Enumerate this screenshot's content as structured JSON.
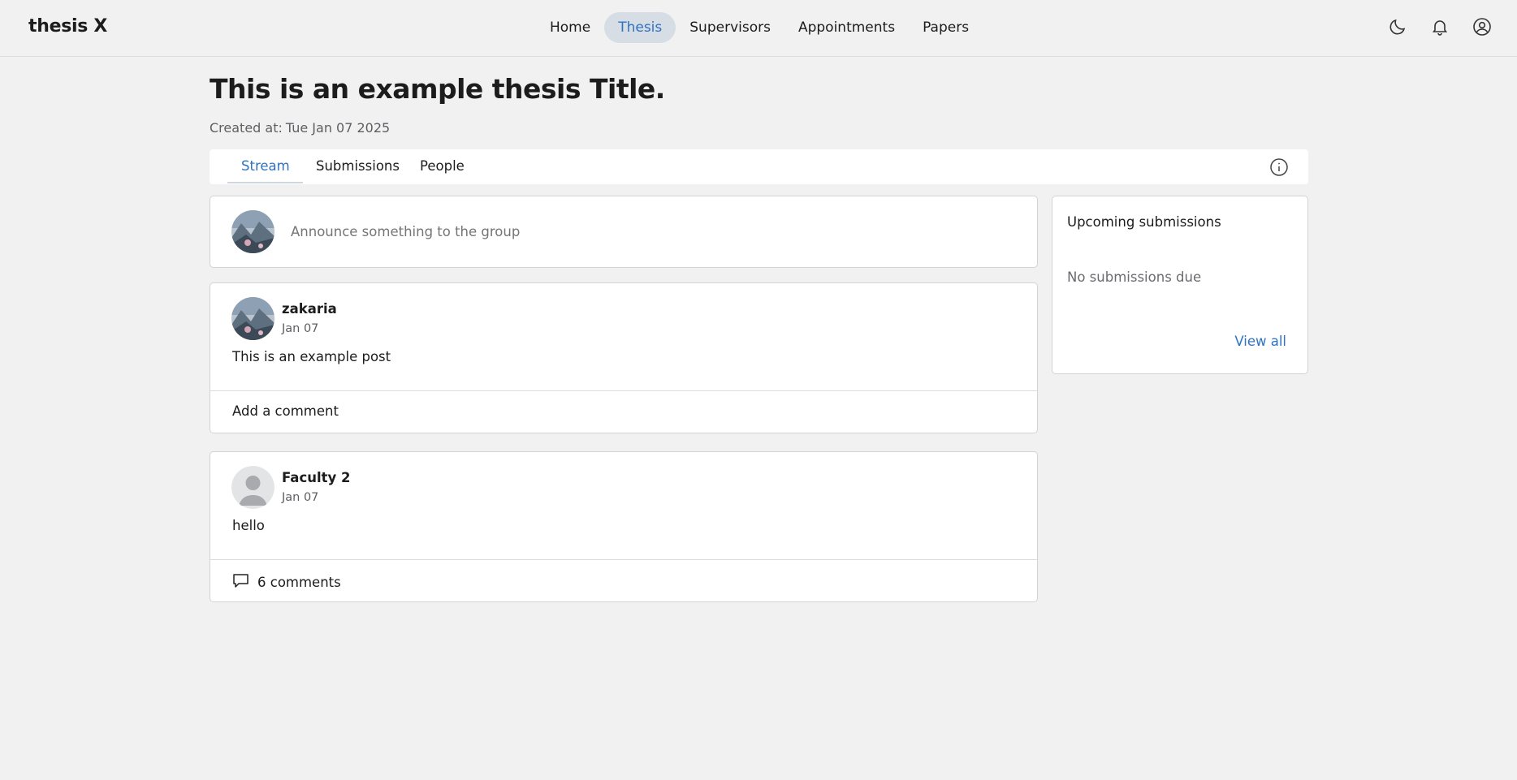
{
  "app": {
    "brand": "thesis X"
  },
  "nav": {
    "items": [
      {
        "label": "Home",
        "active": false
      },
      {
        "label": "Thesis",
        "active": true
      },
      {
        "label": "Supervisors",
        "active": false
      },
      {
        "label": "Appointments",
        "active": false
      },
      {
        "label": "Papers",
        "active": false
      }
    ],
    "icons": [
      "moon-icon",
      "bell-icon",
      "account-icon"
    ]
  },
  "page": {
    "title": "This is an example thesis Title.",
    "created_label": "Created at:",
    "created_value": "Tue Jan 07 2025"
  },
  "tabs": [
    {
      "label": "Stream",
      "active": true
    },
    {
      "label": "Submissions",
      "active": false
    },
    {
      "label": "People",
      "active": false
    }
  ],
  "announce": {
    "placeholder": "Announce something to the group"
  },
  "posts": [
    {
      "author": "zakaria",
      "date": "Jan 07",
      "body": "This is an example post",
      "footer": "Add a comment"
    },
    {
      "author": "Faculty 2",
      "date": "Jan 07",
      "body": "hello",
      "footer": "6 comments"
    }
  ],
  "sidebar": {
    "title": "Upcoming submissions",
    "empty": "No submissions due",
    "link": "View all"
  },
  "colors": {
    "accent": "#2f73c2",
    "active_nav_bg": "#d7dde4",
    "background": "#f1f1f2"
  }
}
